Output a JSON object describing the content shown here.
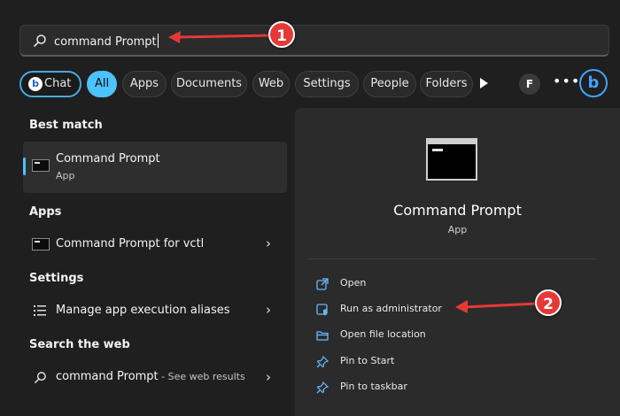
{
  "search": {
    "value": "command Prompt"
  },
  "annotations": {
    "badge_1": "1",
    "badge_2": "2"
  },
  "filters": {
    "chat": "Chat",
    "chips": [
      "All",
      "Apps",
      "Documents",
      "Web",
      "Settings",
      "People",
      "Folders"
    ],
    "avatar_letter": "F",
    "more": "•••",
    "bing_logo": "b"
  },
  "results": {
    "best_match_header": "Best match",
    "best_match": {
      "title": "Command Prompt",
      "subtitle": "App"
    },
    "apps_header": "Apps",
    "apps_item": {
      "title": "Command Prompt",
      "suffix": " for vctl"
    },
    "settings_header": "Settings",
    "settings_item": {
      "title": "Manage app execution aliases"
    },
    "web_header": "Search the web",
    "web_item": {
      "title": "command Prompt",
      "suffix": " - See web results"
    }
  },
  "detail": {
    "title": "Command Prompt",
    "type": "App",
    "actions": [
      "Open",
      "Run as administrator",
      "Open file location",
      "Pin to Start",
      "Pin to taskbar"
    ]
  },
  "colors": {
    "accent": "#4cc2ff",
    "annotation_red": "#e53935",
    "bing_blue": "#3fa3ff"
  },
  "icons": [
    "search-icon",
    "bing-chat-icon",
    "play-icon",
    "more-icon",
    "bing-icon",
    "cmd-icon",
    "settings-list-icon",
    "open-icon",
    "shield-icon",
    "folder-icon",
    "pin-icon",
    "chevron-right-icon"
  ]
}
